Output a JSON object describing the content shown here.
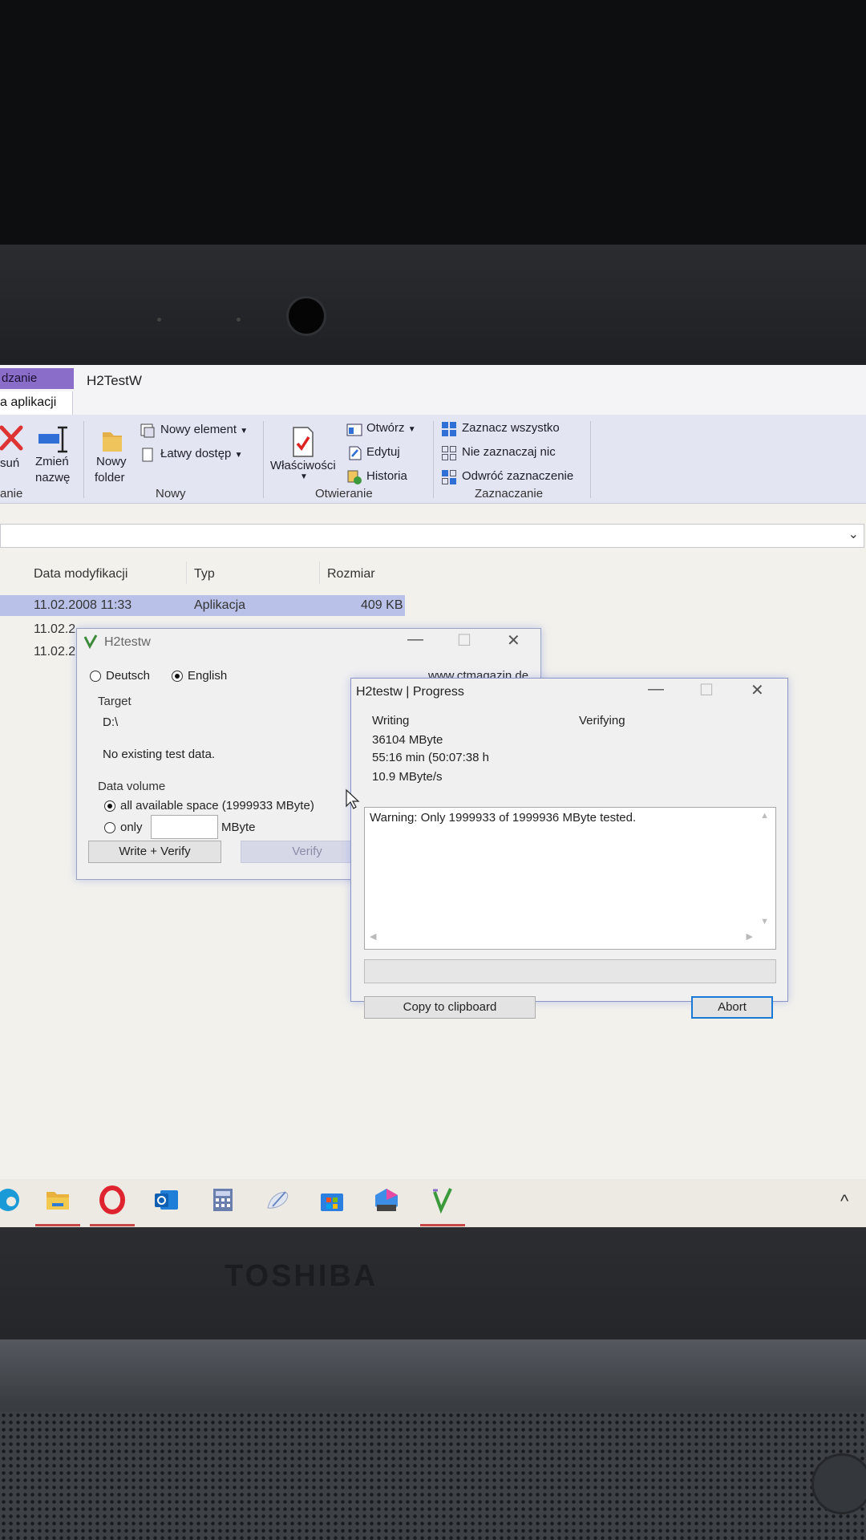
{
  "device": {
    "brand": "TOSHIBA"
  },
  "explorer": {
    "context_tab": "dzanie",
    "context_tab_sub": "a aplikacji",
    "window_title": "H2TestW",
    "ribbon": {
      "delete_label": "suń",
      "rename_label_1": "Zmień",
      "rename_label_2": "nazwę",
      "new_folder_label_1": "Nowy",
      "new_folder_label_2": "folder",
      "new_item_label": "Nowy element",
      "easy_access_label": "Łatwy dostęp",
      "properties_label": "Właściwości",
      "open_label": "Otwórz",
      "edit_label": "Edytuj",
      "history_label": "Historia",
      "select_all_label": "Zaznacz wszystko",
      "select_none_label": "Nie zaznaczaj nic",
      "invert_selection_label": "Odwróć zaznaczenie",
      "group_organize": "anie",
      "group_new": "Nowy",
      "group_open": "Otwieranie",
      "group_select": "Zaznaczanie"
    },
    "columns": {
      "date": "Data modyfikacji",
      "type": "Typ",
      "size": "Rozmiar"
    },
    "rows": [
      {
        "date": "11.02.2008 11:33",
        "type": "Aplikacja",
        "size": "409 KB"
      },
      {
        "date": "11.02.2",
        "type": "",
        "size": ""
      },
      {
        "date": "11.02.2",
        "type": "",
        "size": ""
      }
    ]
  },
  "h2testw_main": {
    "title": "H2testw",
    "lang_de": "Deutsch",
    "lang_en": "English",
    "selected_lang": "English",
    "website": "www.ctmagazin.de",
    "target_label": "Target",
    "target_value": "D:\\",
    "status_text": "No existing test data.",
    "volume_label": "Data volume",
    "opt_all": "all available space (1999933 MByte)",
    "opt_only": "only",
    "only_value": "",
    "unit": "MByte",
    "write_verify_button": "Write + Verify",
    "verify_button": "Verify"
  },
  "h2testw_progress": {
    "title": "H2testw | Progress",
    "writing_header": "Writing",
    "verifying_header": "Verifying",
    "written": "36104 MByte",
    "elapsed": "55:16 min (50:07:38 h",
    "speed": "10.9 MByte/s",
    "log_text": "Warning: Only 1999933 of 1999936 MByte tested.",
    "progress": 0,
    "copy_button": "Copy to clipboard",
    "abort_button": "Abort"
  },
  "taskbar": {
    "apps": [
      "edge-icon",
      "file-explorer-icon",
      "opera-icon",
      "outlook-icon",
      "calculator-icon",
      "paint-icon",
      "microsoft-store-icon",
      "ms365-icon",
      "h2testw-icon"
    ],
    "tray_chevron": "^"
  }
}
